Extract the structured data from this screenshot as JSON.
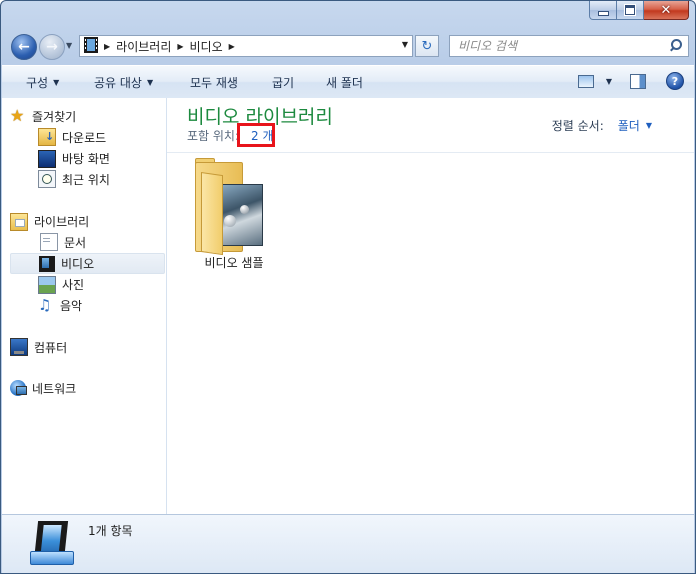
{
  "window": {
    "caption": {
      "minimize": "–",
      "maximize": "□",
      "close": "✕"
    }
  },
  "address": {
    "crumbs": [
      "라이브러리",
      "비디오"
    ],
    "search_placeholder": "비디오 검색"
  },
  "toolbar": {
    "organize": "구성",
    "share": "공유 대상",
    "play_all": "모두 재생",
    "burn": "굽기",
    "new_folder": "새 폴더"
  },
  "nav": {
    "favorites": {
      "label": "즐겨찾기",
      "items": [
        "다운로드",
        "바탕 화면",
        "최근 위치"
      ]
    },
    "libraries": {
      "label": "라이브러리",
      "items": [
        "문서",
        "비디오",
        "사진",
        "음악"
      ],
      "selected": "비디오"
    },
    "computer": "컴퓨터",
    "network": "네트워크"
  },
  "content": {
    "title": "비디오 라이브러리",
    "includes_label": "포함 위치:",
    "includes_count": "2 개",
    "arrange_label": "정렬 순서:",
    "arrange_value": "폴더",
    "items": [
      {
        "name": "비디오 샘플",
        "icon": "folder-with-photo-icon"
      }
    ]
  },
  "details": {
    "summary": "1개 항목",
    "icon": "video-library-icon"
  },
  "colors": {
    "title_green": "#1d8a3f",
    "link_blue": "#1f5fbf",
    "highlight_red": "#e8141b"
  }
}
